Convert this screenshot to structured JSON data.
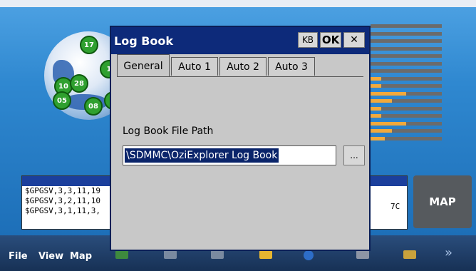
{
  "dialog": {
    "title": "Log Book",
    "kb_label": "KB",
    "ok_label": "OK",
    "close_label": "✕",
    "tabs": [
      "General",
      "Auto 1",
      "Auto 2",
      "Auto 3"
    ],
    "active_tab": "General",
    "path_label": "Log Book File Path",
    "path_value": "\\SDMMC\\OziExplorer Log Book",
    "browse_label": "..."
  },
  "globe": {
    "satellites": [
      "17",
      "1",
      "10",
      "28",
      "05",
      "08",
      "0"
    ]
  },
  "nmea": {
    "lines": [
      "$GPGSV,3,3,11,19",
      "$GPGSV,3,2,11,10",
      "$GPGSV,3,1,11,3,"
    ],
    "right_text": "7C"
  },
  "map_button": "MAP",
  "taskbar": {
    "menu": [
      "File",
      "View",
      "Map"
    ]
  },
  "signal_levels": [
    0,
    0,
    0,
    0,
    0,
    0,
    0,
    0.15,
    0.15,
    0.5,
    0.3,
    0.15,
    0.15,
    0.5,
    0.3,
    0.2
  ],
  "colors": {
    "title_bar": "#0d2a7a",
    "signal_fill": "#f2a93b",
    "satellite": "#2fa02f"
  }
}
